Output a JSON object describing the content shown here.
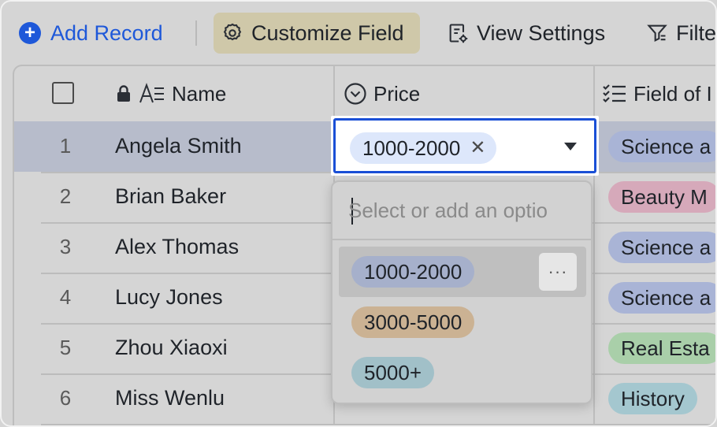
{
  "toolbar": {
    "add_record": "Add Record",
    "customize_field": "Customize Field",
    "view_settings": "View Settings",
    "filter": "Filte"
  },
  "columns": {
    "name": "Name",
    "price": "Price",
    "field": "Field of I"
  },
  "rows": [
    {
      "num": "1",
      "name": "Angela Smith",
      "field": "Science a",
      "field_color": "#a9b4d6"
    },
    {
      "num": "2",
      "name": "Brian Baker",
      "field": "Beauty M",
      "field_color": "#d6a9ba"
    },
    {
      "num": "3",
      "name": "Alex Thomas",
      "field": "Science a",
      "field_color": "#a9b4d6"
    },
    {
      "num": "4",
      "name": "Lucy Jones",
      "field": "Science a",
      "field_color": "#a9b4d6"
    },
    {
      "num": "5",
      "name": "Zhou Xiaoxi",
      "field": "Real Esta",
      "field_color": "#a9cfa9"
    },
    {
      "num": "6",
      "name": "Miss Wenlu",
      "field": "History",
      "field_color": "#a4c7cf"
    }
  ],
  "editor": {
    "selected_value": "1000-2000",
    "remove_symbol": "✕"
  },
  "dropdown": {
    "search_placeholder": "Select or add an optio",
    "options": [
      {
        "label": "1000-2000",
        "color": "#a6b0cb"
      },
      {
        "label": "3000-5000",
        "color": "#cbb293"
      },
      {
        "label": "5000+",
        "color": "#a1c0c8"
      }
    ],
    "more_label": "···"
  },
  "colors": {
    "accent": "#1e58d9",
    "active_row": "#b7bccb",
    "editor_border": "#1a4fd6"
  }
}
